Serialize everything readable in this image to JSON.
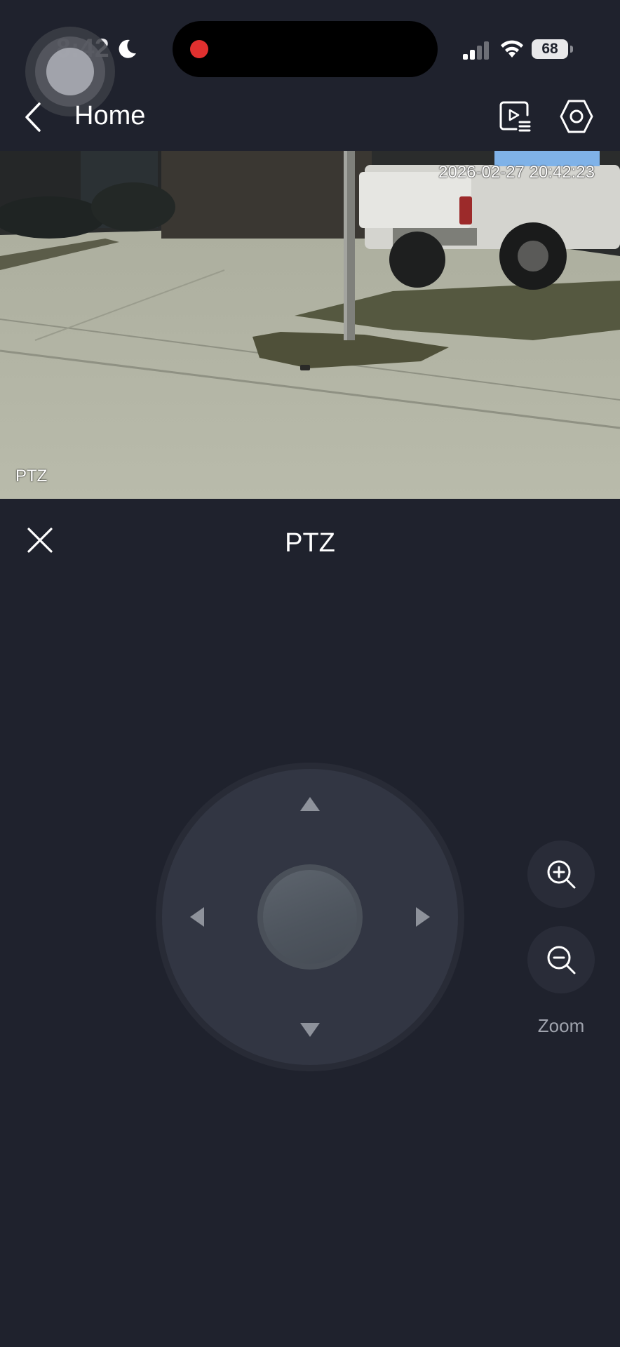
{
  "status_bar": {
    "time": "8:42",
    "battery": "68",
    "icons": [
      "assistive-touch",
      "moon-icon",
      "recording-dot",
      "signal-icon",
      "wifi-icon",
      "battery-icon"
    ]
  },
  "nav": {
    "title": "Home",
    "icons": [
      "back-arrow-icon",
      "playback-list-icon",
      "settings-gear-icon"
    ]
  },
  "camera_feed": {
    "timestamp": "2026-02-27 20:42:23",
    "overlay_label": "PTZ"
  },
  "ptz_panel": {
    "title": "PTZ",
    "close_icon": "close-icon",
    "directions": [
      "up",
      "down",
      "left",
      "right"
    ],
    "zoom_label": "Zoom",
    "zoom_icons": [
      "zoom-in-icon",
      "zoom-out-icon"
    ]
  },
  "colors": {
    "background": "#1f222d",
    "joystick_pad": "#323643",
    "joystick_knob": "#545b64",
    "zoom_button": "#292c38",
    "recording_dot": "#e0302f",
    "label_gray": "#9fa3ad"
  }
}
